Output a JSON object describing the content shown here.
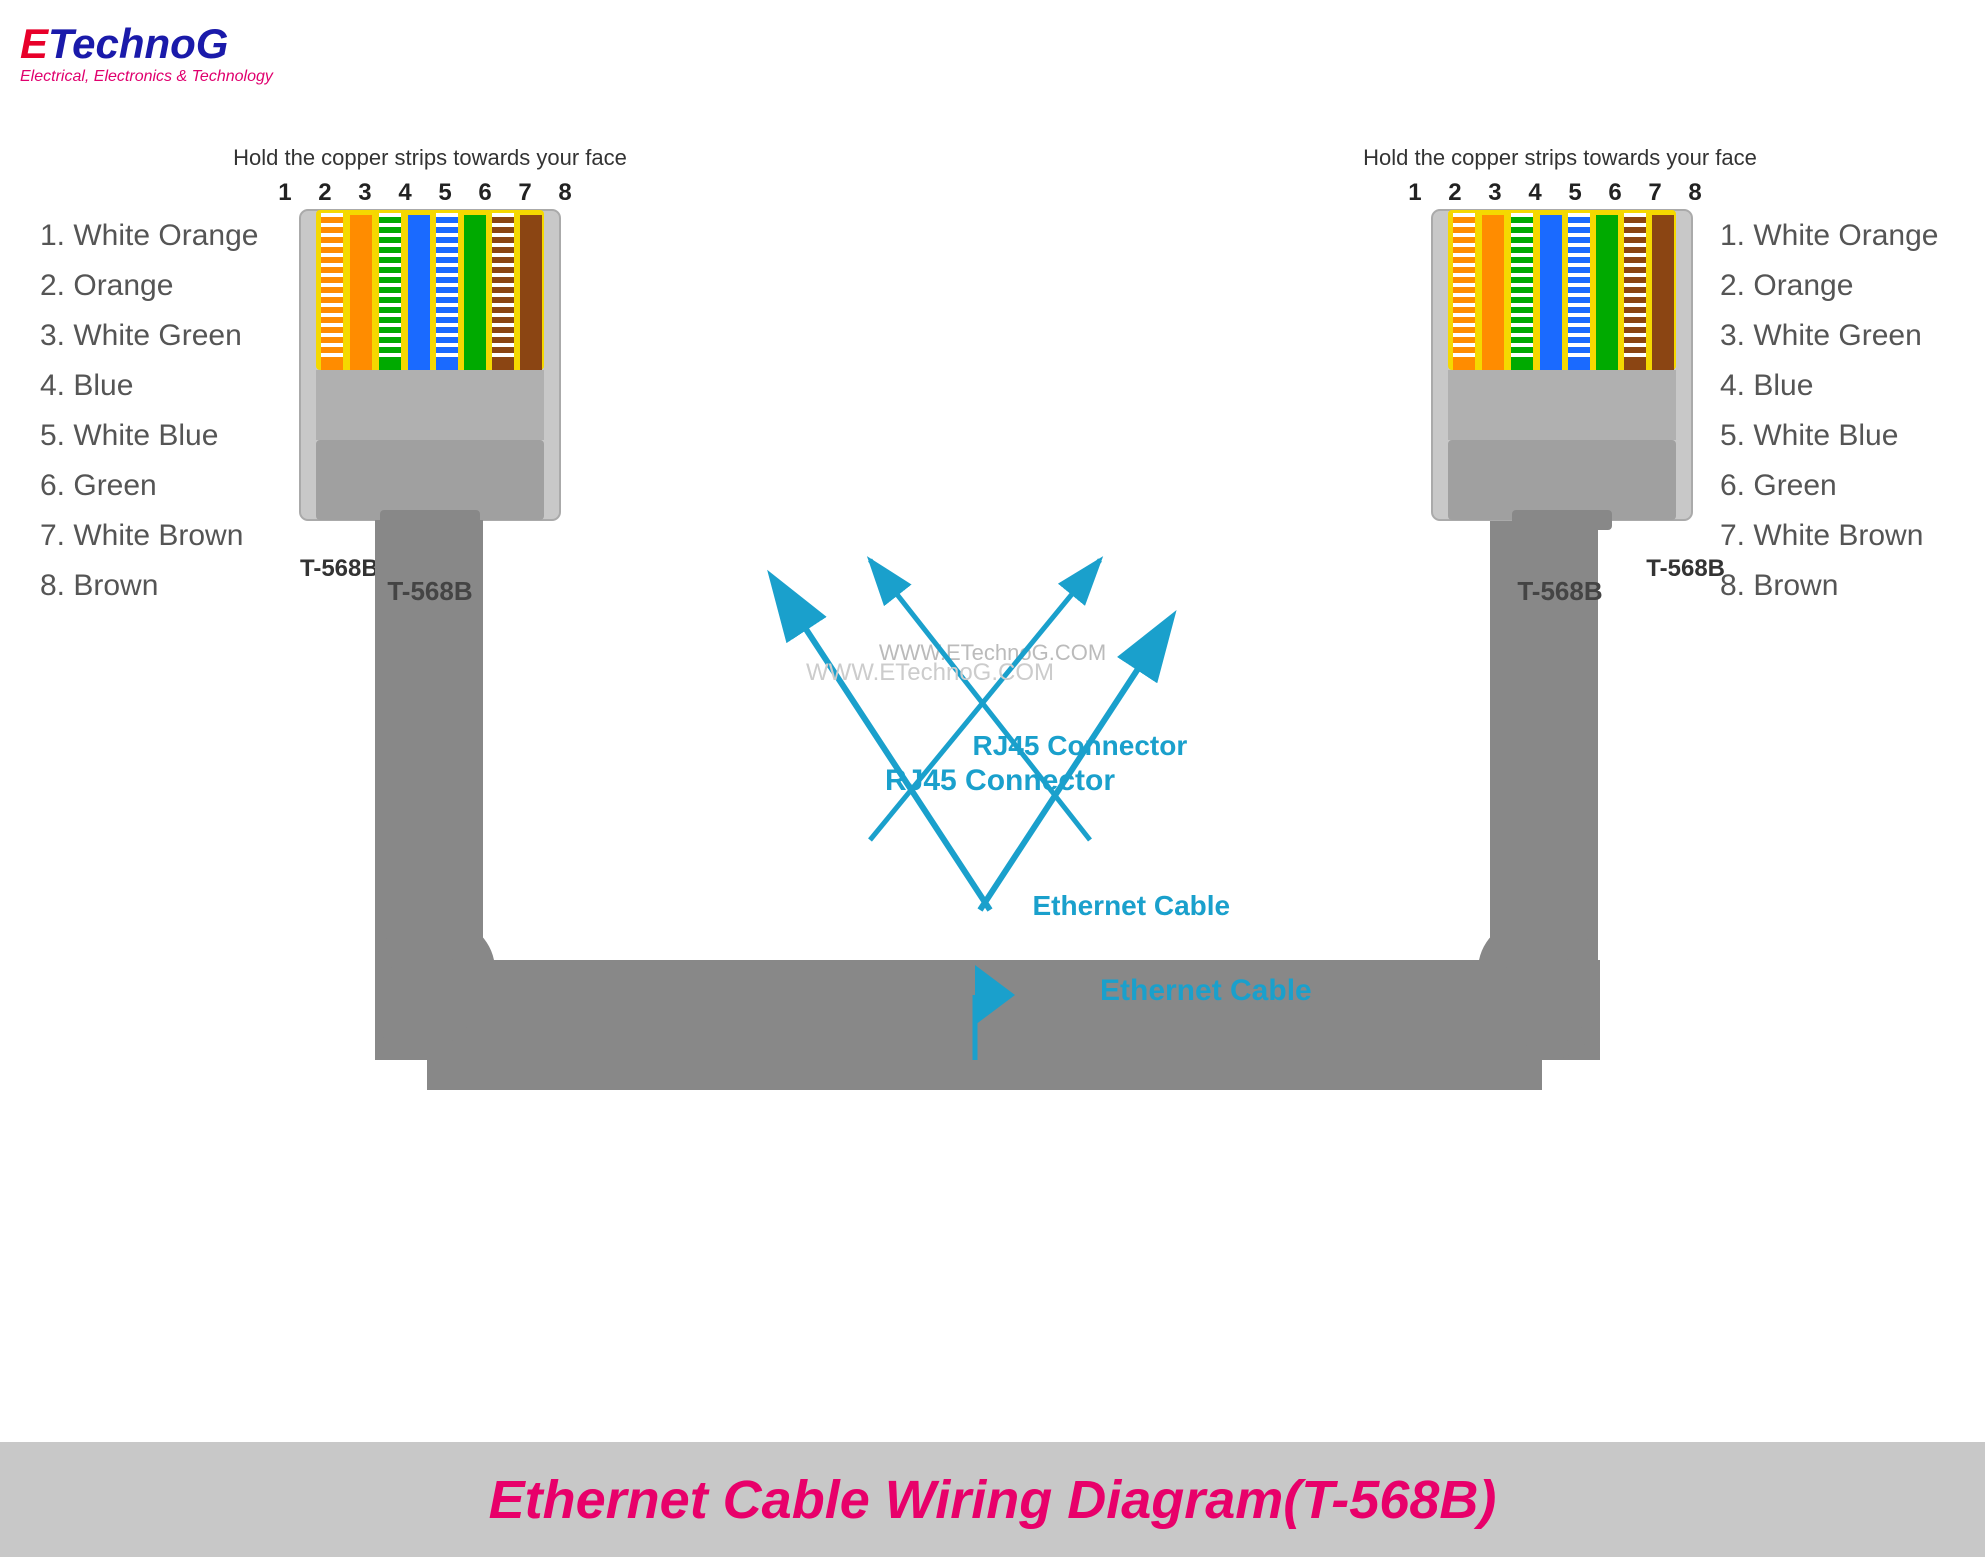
{
  "logo": {
    "e": "E",
    "technog": "TechnoG",
    "subtitle": "Electrical, Electronics & Technology"
  },
  "hold_text": "Hold the copper strips towards your face",
  "pin_numbers": "1 2 3 4 5 6 7 8",
  "labels_left": [
    "1. White Orange",
    "2. Orange",
    "3. White Green",
    "4. Blue",
    "5. White Blue",
    "6. Green",
    "7. White Brown",
    "8. Brown"
  ],
  "labels_right": [
    "1. White Orange",
    "2. Orange",
    "3. White Green",
    "4. Blue",
    "5. White Blue",
    "6. Green",
    "7. White Brown",
    "8. Brown"
  ],
  "standard_left": "T-568B",
  "standard_right": "T-568B",
  "rj45_label": "RJ45 Connector",
  "ethernet_label": "Ethernet Cable",
  "watermark": "WWW.ETechnoG.COM",
  "banner": "Ethernet Cable Wiring Diagram(T-568B)",
  "wire_colors": [
    {
      "stripe": "#ffffff",
      "base": "#ff8c00"
    },
    {
      "stripe": null,
      "base": "#ff8c00"
    },
    {
      "stripe": "#ffffff",
      "base": "#00aa00"
    },
    {
      "stripe": null,
      "base": "#1a6aff"
    },
    {
      "stripe": "#ffffff",
      "base": "#1a6aff"
    },
    {
      "stripe": null,
      "base": "#00aa00"
    },
    {
      "stripe": "#ffffff",
      "base": "#8B4513"
    },
    {
      "stripe": null,
      "base": "#8B4513"
    }
  ]
}
